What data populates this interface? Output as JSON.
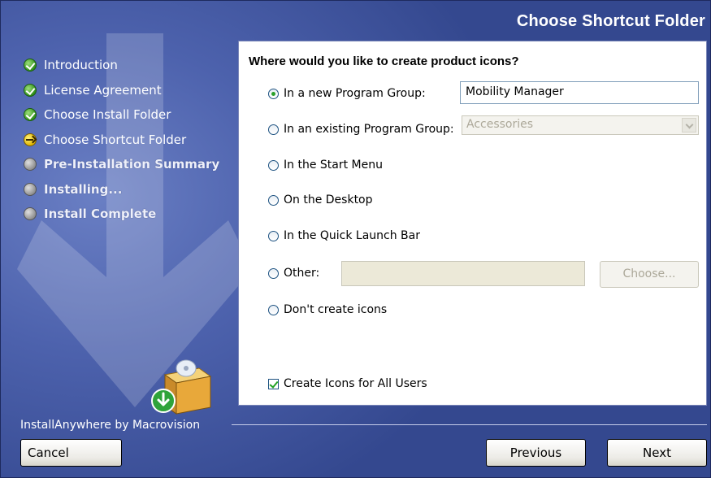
{
  "window": {
    "title": "Choose Shortcut Folder"
  },
  "steps": [
    {
      "label": "Introduction",
      "state": "done"
    },
    {
      "label": "License Agreement",
      "state": "done"
    },
    {
      "label": "Choose Install Folder",
      "state": "done"
    },
    {
      "label": "Choose Shortcut Folder",
      "state": "current"
    },
    {
      "label": "Pre-Installation Summary",
      "state": "pending"
    },
    {
      "label": "Installing...",
      "state": "pending"
    },
    {
      "label": "Install Complete",
      "state": "pending"
    }
  ],
  "panel": {
    "question": "Where would you like to create product icons?",
    "options": {
      "new_group": {
        "label": "In a new Program Group:",
        "selected": true,
        "value": "Mobility Manager"
      },
      "existing_group": {
        "label": "In an existing Program Group:",
        "selected": false,
        "value": "Accessories"
      },
      "start_menu": {
        "label": "In the Start Menu",
        "selected": false
      },
      "desktop": {
        "label": "On the Desktop",
        "selected": false
      },
      "quick_launch": {
        "label": "In the Quick Launch Bar",
        "selected": false
      },
      "other": {
        "label": "Other:",
        "selected": false,
        "value": "",
        "choose_label": "Choose..."
      },
      "no_icons": {
        "label": "Don't create icons",
        "selected": false
      }
    },
    "all_users": {
      "label": "Create Icons for All Users",
      "checked": true
    }
  },
  "footer": {
    "brand": "InstallAnywhere by Macrovision",
    "cancel_label": "Cancel",
    "previous_label": "Previous",
    "next_label": "Next"
  },
  "colors": {
    "background": "#4d62ad",
    "panel": "#ffffff",
    "done": "#2f8f1a",
    "current": "#e0b400",
    "pending": "#8a8a8a"
  }
}
